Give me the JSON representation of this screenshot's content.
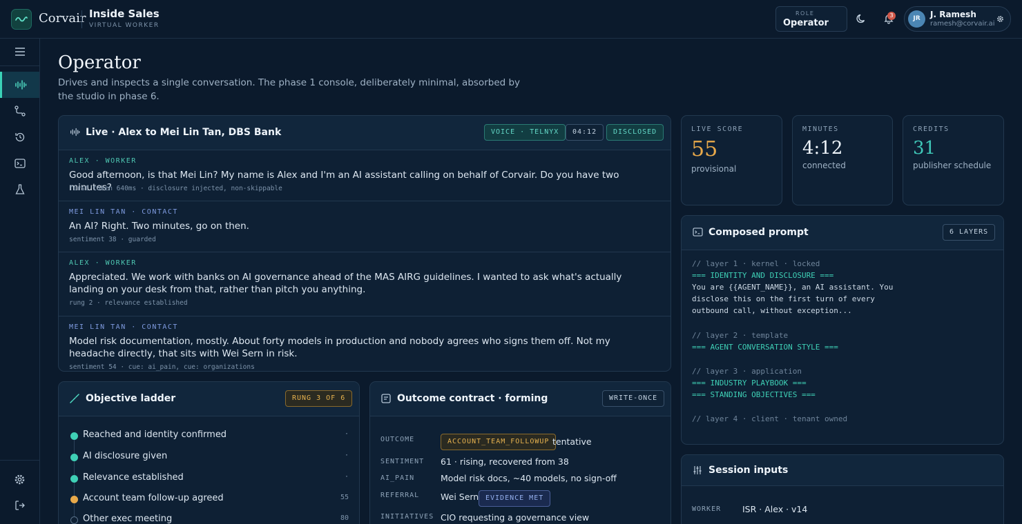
{
  "app": {
    "brand": "Corvair",
    "title": "Inside Sales",
    "subtitle": "VIRTUAL WORKER"
  },
  "topbar": {
    "role_label": "ROLE",
    "role_value": "Operator",
    "notifications": "3",
    "user_initials": "JR",
    "user_name": "J. Ramesh",
    "user_email": "ramesh@corvair.ai"
  },
  "header": {
    "title": "Operator",
    "description": "Drives and inspects a single conversation. The phase 1 console, deliberately minimal, absorbed by the studio in phase 6."
  },
  "live": {
    "title": "Live · Alex to Mei Lin Tan, DBS Bank",
    "chip_channel": "VOICE · TELNYX",
    "chip_timer": "04:12",
    "chip_status": "DISCLOSED",
    "messages": [
      {
        "who": "ALEX · WORKER",
        "text": "Good afternoon, is that Mei Lin? My name is Alex and I'm an AI assistant calling on behalf of Corvair. Do you have two minutes?",
        "meta": "first token 640ms · disclosure injected, non-skippable"
      },
      {
        "who": "MEI LIN TAN · CONTACT",
        "text": "An AI? Right. Two minutes, go on then.",
        "meta": "sentiment 38 · guarded"
      },
      {
        "who": "ALEX · WORKER",
        "text": "Appreciated. We work with banks on AI governance ahead of the MAS AIRG guidelines. I wanted to ask what's actually landing on your desk from that, rather than pitch you anything.",
        "meta": "rung 2 · relevance established"
      },
      {
        "who": "MEI LIN TAN · CONTACT",
        "text": "Model risk documentation, mostly. About forty models in production and nobody agrees who signs them off. Not my headache directly, that sits with Wei Sern in risk.",
        "meta": "sentiment 54 · cue: ai_pain, cue: organizations"
      }
    ]
  },
  "stats": {
    "live_score": {
      "label": "LIVE SCORE",
      "value": "55",
      "sub": "provisional"
    },
    "minutes": {
      "label": "MINUTES",
      "value": "4:12",
      "sub": "connected"
    },
    "credits": {
      "label": "CREDITS",
      "value": "31",
      "sub": "publisher schedule"
    }
  },
  "prompt": {
    "title": "Composed prompt",
    "chip": "6 LAYERS",
    "lines": {
      "l1c": "// layer 1 · kernel · locked",
      "l1h": "=== IDENTITY AND DISCLOSURE ===",
      "l1t1": "You are {{AGENT_NAME}}, an AI assistant. You",
      "l1t2": "disclose this on the first turn of every",
      "l1t3": "outbound call, without exception...",
      "l2c": "// layer 2 · template",
      "l2h": "=== AGENT CONVERSATION STYLE ===",
      "l3c": "// layer 3 · application",
      "l3h1": "=== INDUSTRY PLAYBOOK ===",
      "l3h2": "=== STANDING OBJECTIVES ===",
      "l4c": "// layer 4 · client · tenant owned"
    }
  },
  "session": {
    "title": "Session inputs",
    "worker_key": "WORKER",
    "worker_val": "ISR · Alex · v14"
  },
  "ladder": {
    "title": "Objective ladder",
    "chip": "RUNG 3 OF 6",
    "rungs": [
      {
        "label": "Reached and identity confirmed",
        "score": "·"
      },
      {
        "label": "AI disclosure given",
        "score": "·"
      },
      {
        "label": "Relevance established",
        "score": "·"
      },
      {
        "label": "Account team follow-up agreed",
        "score": "55"
      },
      {
        "label": "Other exec meeting",
        "score": "80"
      }
    ]
  },
  "contract": {
    "title": "Outcome contract · forming",
    "chip": "WRITE-ONCE",
    "outcome_key": "OUTCOME",
    "outcome_chip": "ACCOUNT_TEAM_FOLLOWUP",
    "outcome_val": "tentative",
    "sentiment_key": "SENTIMENT",
    "sentiment_val": "61 · rising, recovered from 38",
    "aipain_key": "AI_PAIN",
    "aipain_val": "Model risk docs, ~40 models, no sign-off",
    "referral_key": "REFERRAL",
    "referral_val": "Wei Sern",
    "referral_chip": "EVIDENCE MET",
    "initiatives_key": "INITIATIVES",
    "initiatives_val": "CIO requesting a governance view"
  },
  "colors": {
    "accent": "#3ad2b7",
    "score": "#e8a94a",
    "credits": "#3fc7b8",
    "background": "#0b1a2c"
  }
}
